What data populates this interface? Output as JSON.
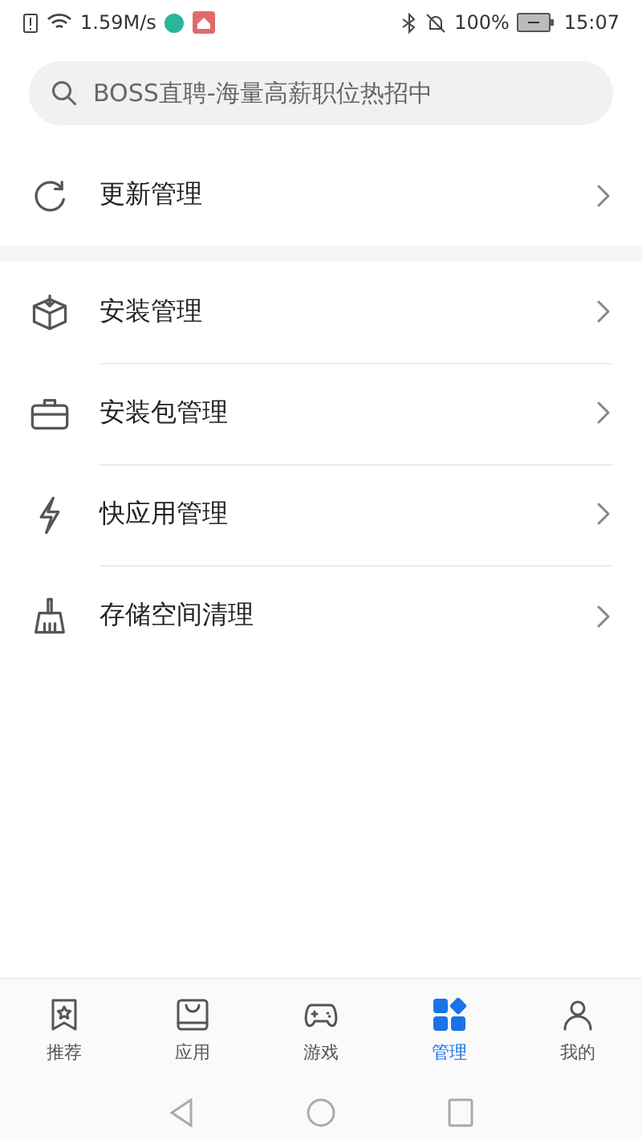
{
  "status_bar": {
    "speed": "1.59M/s",
    "battery": "100%",
    "time": "15:07"
  },
  "search": {
    "placeholder": "BOSS直聘-海量高薪职位热招中"
  },
  "sections": [
    {
      "items": [
        {
          "kind": "update",
          "label": "更新管理"
        }
      ]
    },
    {
      "items": [
        {
          "kind": "install",
          "label": "安装管理"
        },
        {
          "kind": "package",
          "label": "安装包管理"
        },
        {
          "kind": "quickapp",
          "label": "快应用管理"
        },
        {
          "kind": "storage",
          "label": "存储空间清理"
        }
      ]
    }
  ],
  "tabs": [
    {
      "kind": "recommend",
      "label": "推荐",
      "selected": false
    },
    {
      "kind": "apps",
      "label": "应用",
      "selected": false
    },
    {
      "kind": "games",
      "label": "游戏",
      "selected": false
    },
    {
      "kind": "manage",
      "label": "管理",
      "selected": true
    },
    {
      "kind": "mine",
      "label": "我的",
      "selected": false
    }
  ]
}
